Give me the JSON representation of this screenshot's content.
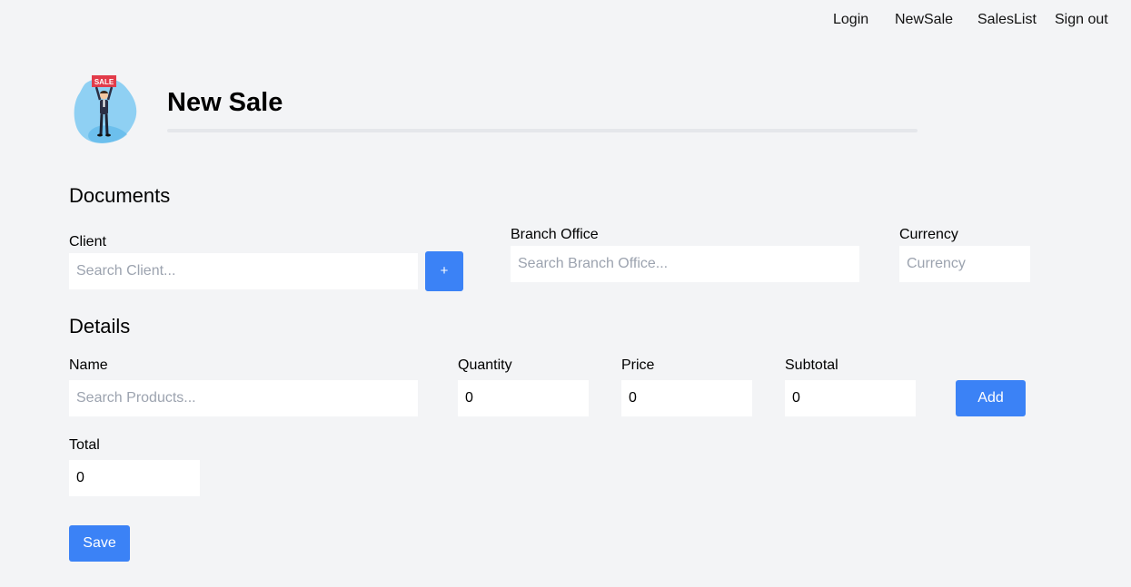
{
  "nav": {
    "login": "Login",
    "new_sale": "NewSale",
    "sales_list": "SalesList",
    "sign_out": "Sign out"
  },
  "logo": {
    "sign_text": "SALE"
  },
  "page": {
    "title": "New Sale"
  },
  "documents": {
    "heading": "Documents",
    "client_label": "Client",
    "client_placeholder": "Search Client...",
    "add_client_button": "+",
    "branch_label": "Branch Office",
    "branch_placeholder": "Search Branch Office...",
    "currency_label": "Currency",
    "currency_placeholder": "Currency"
  },
  "details": {
    "heading": "Details",
    "name_label": "Name",
    "name_placeholder": "Search Products...",
    "quantity_label": "Quantity",
    "quantity_value": "0",
    "price_label": "Price",
    "price_value": "0",
    "subtotal_label": "Subtotal",
    "subtotal_value": "0",
    "add_button": "Add",
    "total_label": "Total",
    "total_value": "0"
  },
  "save_button": "Save",
  "colors": {
    "accent": "#3b82f6",
    "background": "#f3f4f6",
    "input_background": "#ffffff"
  }
}
